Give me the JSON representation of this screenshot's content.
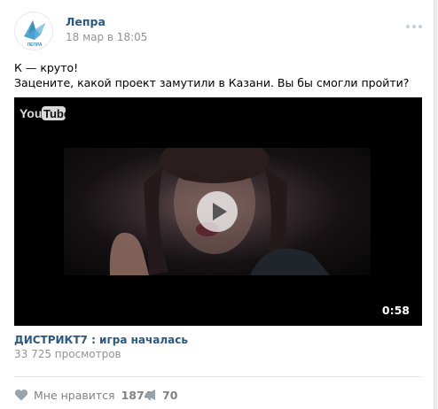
{
  "post": {
    "author": "Лепра",
    "date": "18 мар в 18:05",
    "avatar_text": "ЛЕПРА",
    "text_line1": "К — круто!",
    "text_line2": "Зацените, какой проект замутили в Казани. Вы бы смогли пройти?"
  },
  "video": {
    "logo_you": "You",
    "logo_tube": "Tube",
    "duration": "0:58",
    "title": "ДИСТРИКТ7 : игра началась",
    "views": "33 725 просмотров"
  },
  "actions": {
    "like_label": "Мне нравится",
    "like_count": "1874",
    "share_count": "70"
  },
  "colors": {
    "link": "#2a5885",
    "muted": "#939393",
    "icon": "#99a2ad",
    "brand": "#5fb0d8"
  }
}
